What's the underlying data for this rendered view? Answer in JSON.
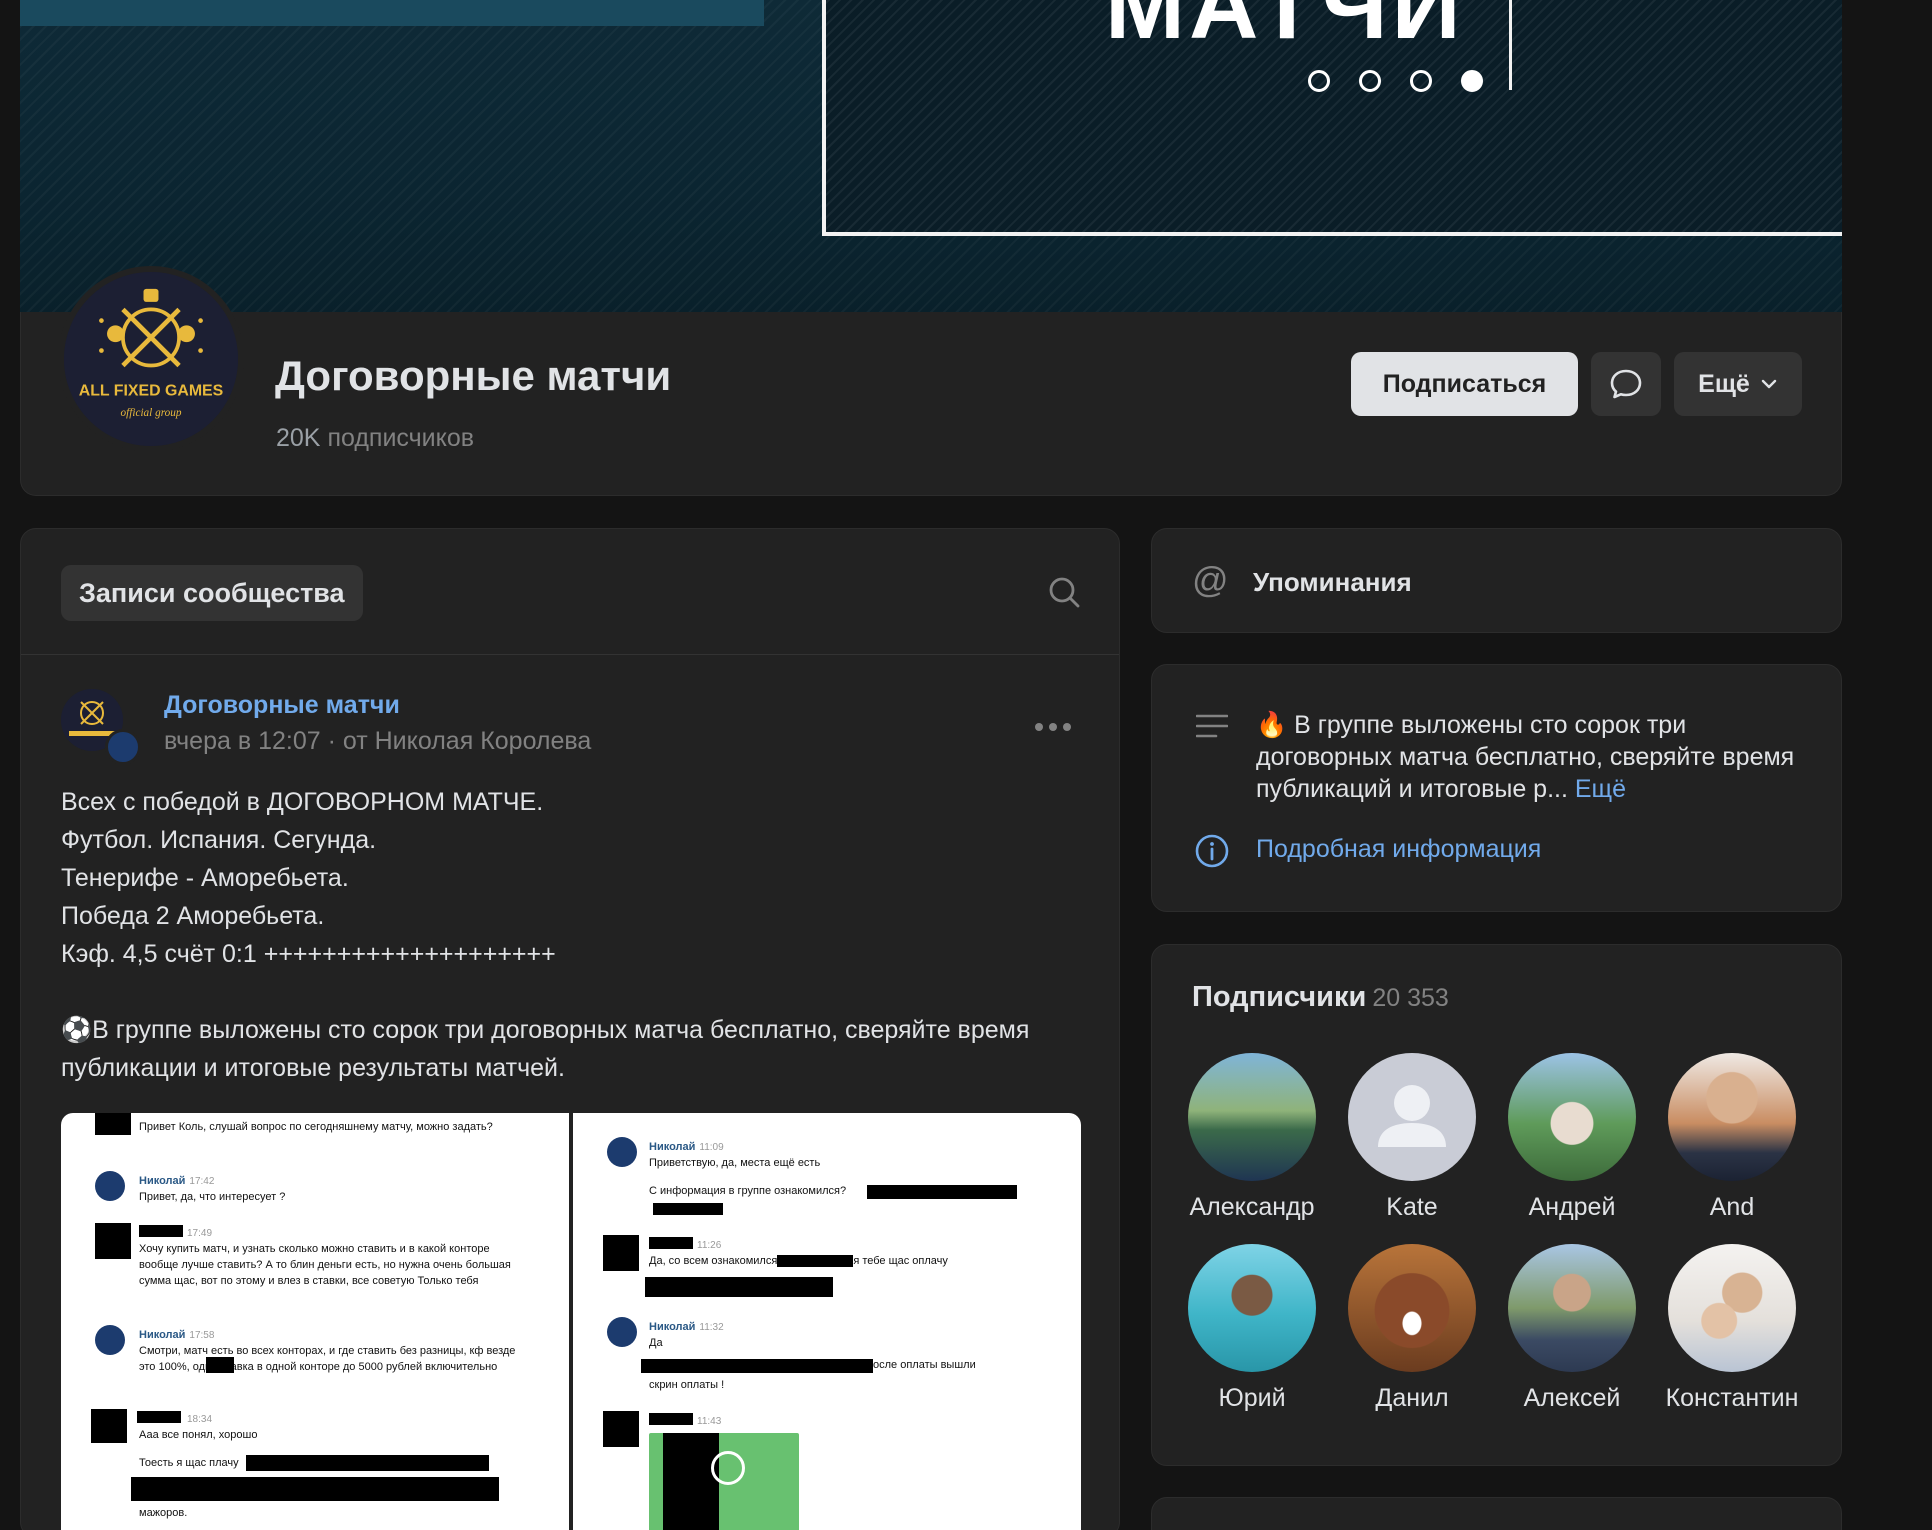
{
  "cover": {
    "title": "МАТЧИ",
    "slide_count": 4,
    "active_slide": 4
  },
  "group": {
    "name": "Договорные матчи",
    "subscribers_number": "20K",
    "subscribers_label": "подписчиков",
    "avatar_text": "ALL FIXED GAMES",
    "avatar_subtext": "official group"
  },
  "actions": {
    "subscribe_label": "Подписаться",
    "message_icon": "message-bubble-icon",
    "more_label": "Ещё",
    "more_icon": "chevron-down-icon"
  },
  "wall": {
    "tab_label": "Записи сообщества",
    "search_icon": "search-icon"
  },
  "post": {
    "author": "Договорные матчи",
    "date": "вчера в 12:07",
    "separator": "·",
    "from": "от Николая Королева",
    "text": "Всех с победой в ДОГОВОРНОМ МАТЧЕ.\nФутбол. Испания. Сегунда.\nТенерифе - Аморебьета.\nПобеда 2 Аморебьета.\nКэф. 4,5 счёт 0:1 ++++++++++++++++++++\n\n⚽️В группе выложены сто сорок три договорных матча бесплатно, сверяйте время публикации и итоговые результаты матчей.",
    "screenshot_left": {
      "m1": "Привет Коль, слушай вопрос по сегодняшнему матчу, можно задать?",
      "m2_name": "Николай",
      "m2_time": "17:42",
      "m2": "Привет, да, что интересует ?",
      "m3_time": "17:49",
      "m3": "Хочу купить матч, и узнать сколько можно ставить и в какой конторе вообще лучше ставить? А то блин деньги есть, но нужна очень большая сумма щас, вот по этому и влез в ставки, все советую Только тебя",
      "m4_name": "Николай",
      "m4_time": "17:58",
      "m4": "Смотри, матч есть во всех конторах, и где ставить без разницы, кф везде это 100%, одна ставка в одной конторе до 5000 рублей включительно",
      "m5_time": "18:34",
      "m5": "Ааа все понял, хорошо",
      "m6": "Тоесть я щас плачу",
      "m7": "мажоров."
    },
    "screenshot_right": {
      "m1_name": "Николай",
      "m1_time": "11:09",
      "m1": "Приветствую, да, места ещё есть",
      "m2": "С информация в группе ознакомился?",
      "m3_time": "11:26",
      "m3a": "Да, со всем ознакомился",
      "m3b": "я тебе щас оплачу",
      "m4_name": "Николай",
      "m4_time": "11:32",
      "m4": "Да",
      "m5a": "осле оплаты вышли",
      "m5b": "скрин оплаты !",
      "m6_time": "11:43"
    }
  },
  "mentions": {
    "icon": "at-icon",
    "label": "Упоминания"
  },
  "about": {
    "icon": "lines-icon",
    "description": "🔥 В группе выложены сто сорок три договорных матча бесплатно, сверяйте время публикаций и итоговые р...",
    "more_label": "Ещё",
    "info_icon": "info-icon",
    "info_label": "Подробная информация"
  },
  "subscribers": {
    "title": "Подписчики",
    "count": "20 353",
    "items": [
      {
        "name": "Александр"
      },
      {
        "name": "Kate"
      },
      {
        "name": "Андрей"
      },
      {
        "name": "And"
      },
      {
        "name": "Юрий"
      },
      {
        "name": "Данил"
      },
      {
        "name": "Алексей"
      },
      {
        "name": "Константин"
      }
    ]
  },
  "colors": {
    "background": "#141414",
    "card": "#222222",
    "link": "#71aaeb",
    "muted": "#828282",
    "text": "#e1e3e6",
    "primary_button": "#e1e3e6"
  }
}
